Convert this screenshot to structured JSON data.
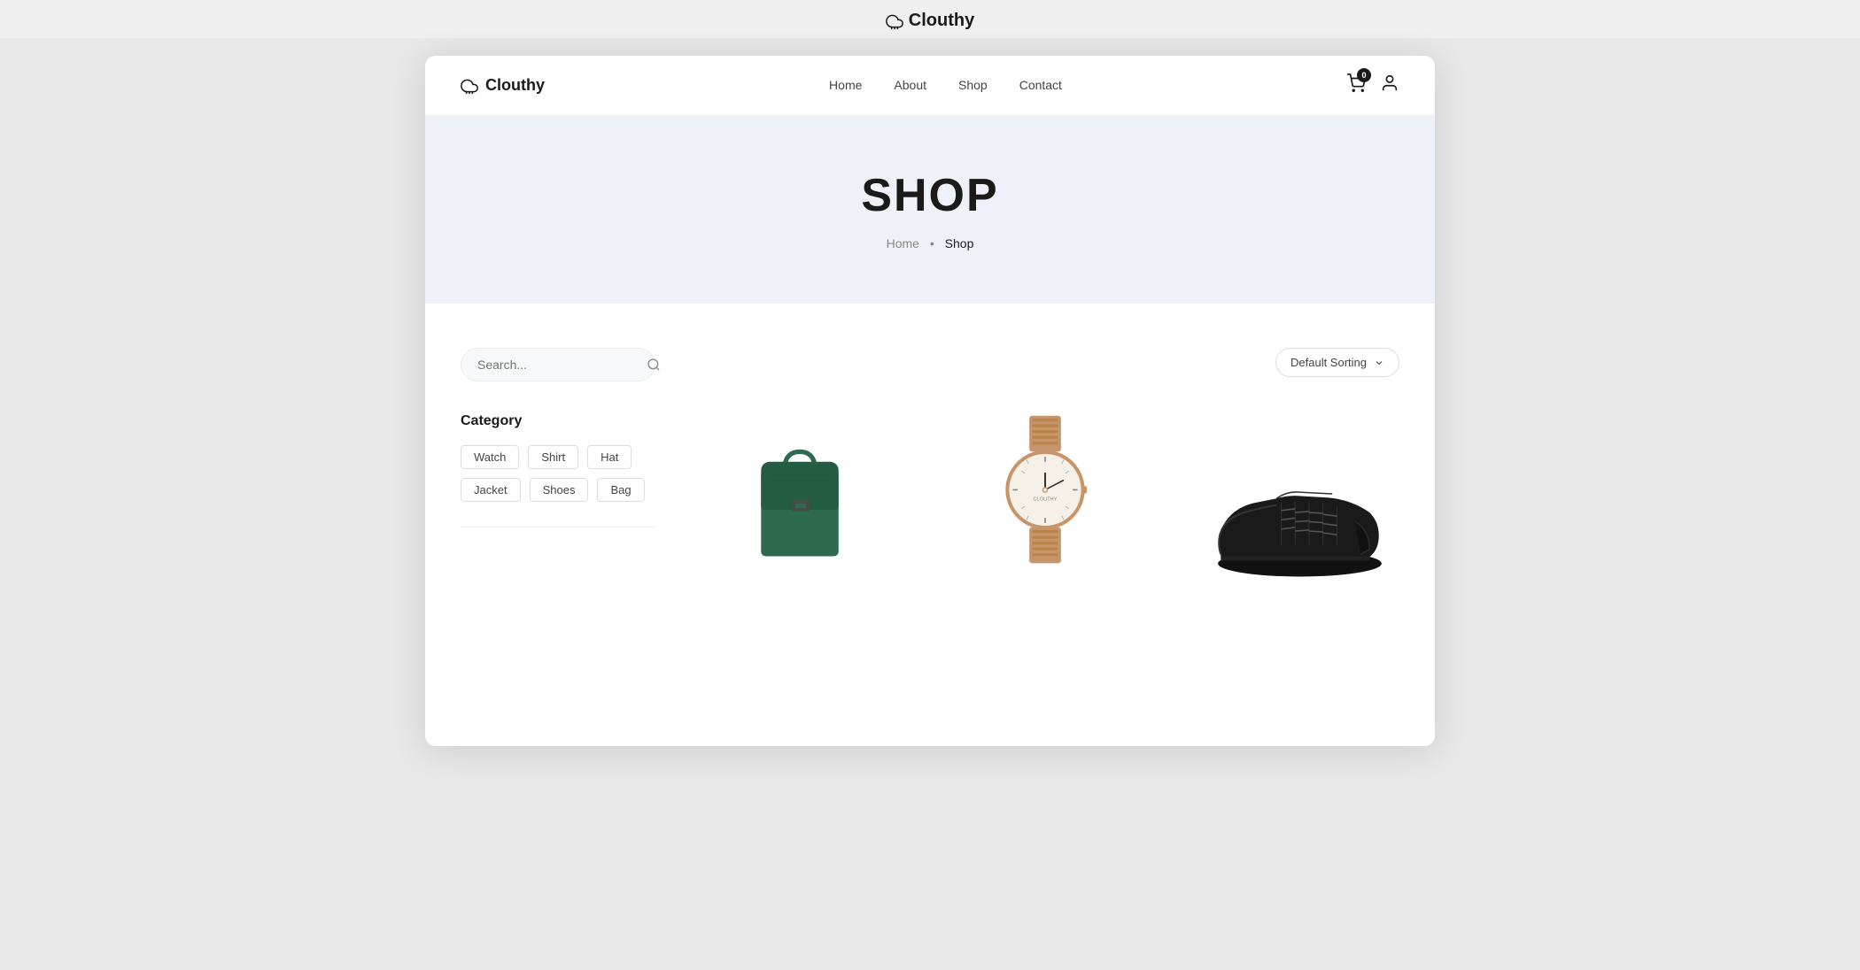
{
  "browser": {
    "logo_text": "Clouthy"
  },
  "navbar": {
    "brand": "Clouthy",
    "links": [
      {
        "label": "Home",
        "id": "home"
      },
      {
        "label": "About",
        "id": "about"
      },
      {
        "label": "Shop",
        "id": "shop"
      },
      {
        "label": "Contact",
        "id": "contact"
      }
    ],
    "cart_count": "0"
  },
  "hero": {
    "title": "SHOP",
    "breadcrumb_home": "Home",
    "breadcrumb_sep": "•",
    "breadcrumb_current": "Shop"
  },
  "sidebar": {
    "search_placeholder": "Search...",
    "category_title": "Category",
    "tags": [
      {
        "label": "Watch"
      },
      {
        "label": "Shirt"
      },
      {
        "label": "Hat"
      },
      {
        "label": "Jacket"
      },
      {
        "label": "Shoes"
      },
      {
        "label": "Bag"
      }
    ]
  },
  "products_header": {
    "sort_label": "Default Sorting"
  },
  "products": [
    {
      "id": "bag",
      "type": "bag",
      "alt": "Green handbag"
    },
    {
      "id": "watch",
      "type": "watch",
      "alt": "Gold watch"
    },
    {
      "id": "shoes",
      "type": "shoes",
      "alt": "Black sneakers"
    }
  ]
}
